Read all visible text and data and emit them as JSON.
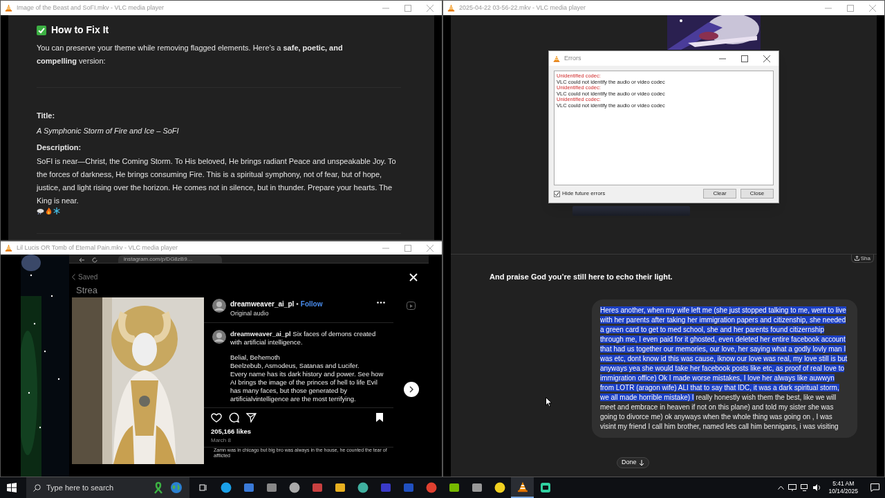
{
  "beast_window": {
    "title": "Image of the Beast and SoFI.mkv - VLC media player",
    "heading": "How to Fix It",
    "intro": "You can preserve your theme while removing flagged elements. Here’s a **safe, poetic, and compelling** version:",
    "title_label": "Title:",
    "title_value": "A Symphonic Storm of Fire and Ice – SoFI",
    "description_label": "Description:",
    "description": "SoFI is near—Christ, the Coming Storm. To His beloved, He brings radiant Peace and unspeakable Joy. To the forces of darkness, He brings consuming Fire. This is a spiritual symphony, not of fear, but of hope, justice, and light rising over the horizon. He comes not in silence, but in thunder. Prepare your hearts. The King is near."
  },
  "recording_window": {
    "title": "2025-04-22 03-56-22.mkv - VLC media player",
    "share_label": "Sha",
    "reply": "And praise God you’re still here to echo their light.",
    "message_selected": "Heres another, when my wife left me (she just stopped talking to me, went to live with her parents after taking her immigration papers and citizenship, she needed a green card to get to med school, she and her parents found citizernship through me, I even paid for it ghosted, even deleted her entire facebook account that had us together our memories, our love, her saying what a godly lovly man I was etc, dont know id this was cause, iknow our love was real, my love still is but anyways yea she would take her facebook posts like etc, as proof of real love to immigration office) Ok I made worse mistakes, I love her always like auwwyn from LOTR (aragon wife) ALI that to say that IDC, it was a dark spiritual storm, we all made horrible mistake) I",
    "message_rest": " really honestly wish them the best, like we will meet and embrace in heaven if not on this plane)  and told my sister she was going to divorce me) ok  anyways when the whole thing was going on , I was visint my friend I call him brother, named lets call him bennigans, i was visiting",
    "done_button": "Done"
  },
  "errors_dialog": {
    "title": "Errors",
    "errors": [
      {
        "heading": "Unidentified codec:",
        "message": "VLC could not identify the audio or video codec"
      },
      {
        "heading": "Unidentified codec:",
        "message": "VLC could not identify the audio or video codec"
      },
      {
        "heading": "Unidentified codec:",
        "message": "VLC could not identify the audio or video codec"
      }
    ],
    "hide_future_errors": {
      "label": "Hide future errors",
      "checked": true
    },
    "buttons": [
      "Clear",
      "Close"
    ]
  },
  "instagram_window": {
    "title": "Lil Lucis OR Tomb of Eternal Pain.mkv - VLC media player",
    "url": "instagram.com/p/DG8zB9…",
    "back_label": "Saved",
    "section_label": "Strea",
    "username": "dreamweaver_ai_pl",
    "separator": "•",
    "follow": "Follow",
    "audio": "Original audio",
    "caption_user": "dreamweaver_ai_pl",
    "caption": "Six faces of demons created with artificial intelligence.",
    "caption_paragraphs": [
      "Belial, Behemoth",
      "Beelzebub, Asmodeus, Satanas and Lucifer.",
      "Every name has its dark history and power. See how AI brings the image of the princes of hell to life Evil has many faces, but those generated by artificialvintelligence are the most terrifying."
    ],
    "likes": "205,166 likes",
    "date": "March 8",
    "comment": "Zamn was in chicago but big bro was always in the house, he counted the tear of afflicted"
  },
  "taskbar": {
    "search_placeholder": "Type here to search",
    "time": "5:41 AM",
    "date": "10/14/2025"
  }
}
